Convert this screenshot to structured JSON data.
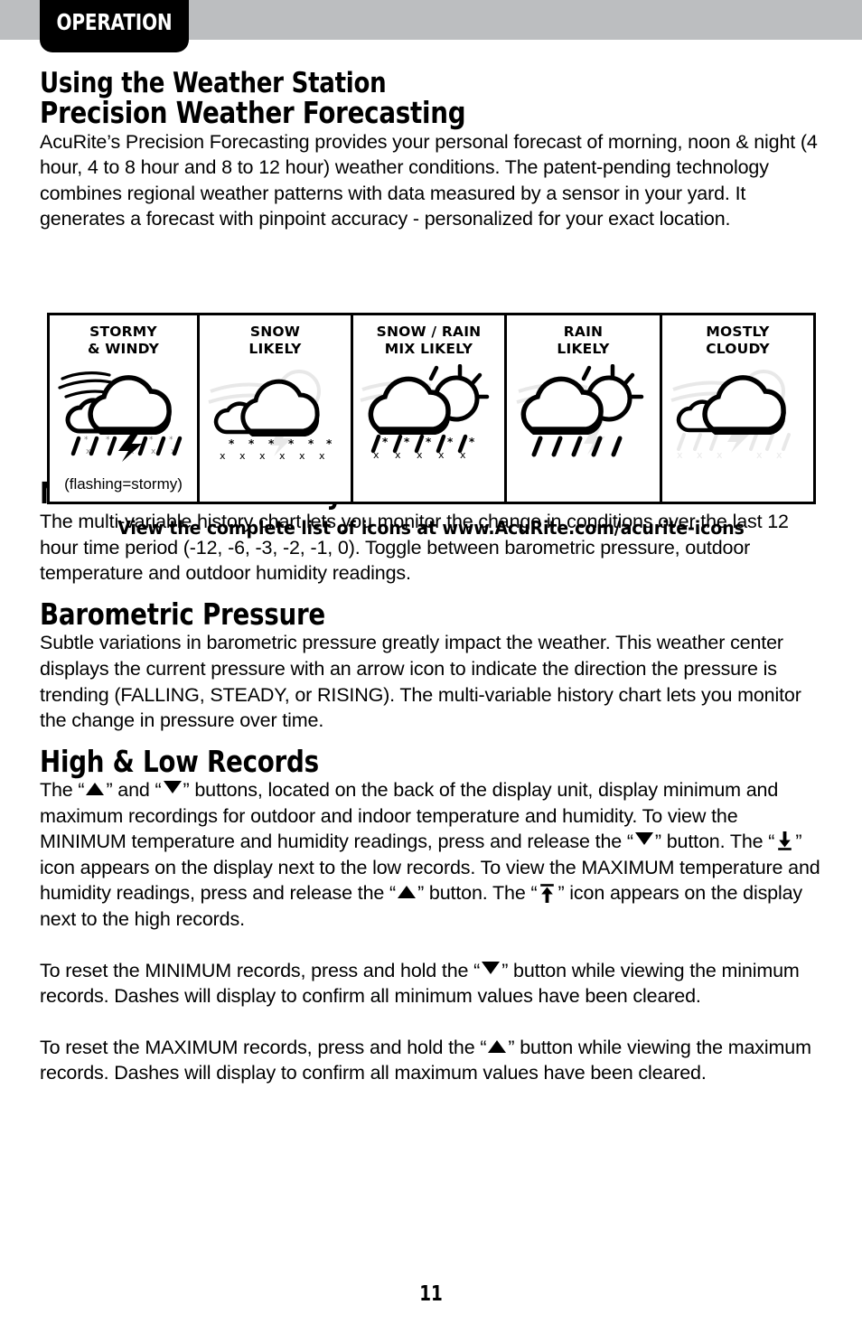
{
  "header": {
    "section_tab_label": "OPERATION",
    "bar_color": "#bcbec0",
    "tab_color": "#000000",
    "tab_text_color": "#ffffff"
  },
  "headings": {
    "page_title": "Using the Weather Station",
    "precision_forecasting": "Precision Weather Forecasting",
    "multi_variable_history_chart": "Multi-Variable History Chart",
    "barometric_pressure": "Barometric Pressure",
    "high_low_records": "High & Low Records"
  },
  "paragraphs": {
    "precision_body": "AcuRite’s Precision Forecasting provides your personal forecast of morning, noon & night (4 hour, 4 to 8 hour and 8 to 12 hour) weather conditions. The patent-pending technology combines regional weather patterns with data measured by a sensor in your yard. It generates a forecast with pinpoint accuracy - personalized for your exact location.",
    "multi_variable_body": "The multi-variable history chart lets you monitor the change in conditions over the last 12 hour time period (-12, -6, -3, -2, -1, 0). Toggle between barometric pressure, outdoor temperature and outdoor humidity readings.",
    "barometric_body": "Subtle variations in barometric pressure greatly impact the weather. This weather center displays the current pressure with an arrow icon to indicate the direction the pressure is trending (FALLING, STEADY, or RISING). The multi-variable history chart lets you monitor the change in pressure over time.",
    "records_p1_a": "The “",
    "records_p1_b": "” and “",
    "records_p1_c": "” buttons, located on the back of the display unit, display minimum and maximum recordings for outdoor and indoor temperature and humidity. To view the MINIMUM temperature and humidity readings, press and release the “",
    "records_p1_d": "” button. The “",
    "records_p1_e": "” icon appears on the display next to the low records. To view the MAXIMUM temperature and humidity readings, press and release the “",
    "records_p1_f": "” button. The “",
    "records_p1_g": "” icon appears on the display next to the high records.",
    "records_p2_a": "To reset the MINIMUM records, press and hold the “",
    "records_p2_b": "” button while viewing the minimum records. Dashes will display to confirm all minimum values have been cleared.",
    "records_p3_a": "To reset the MAXIMUM records, press and hold the “",
    "records_p3_b": "” button while viewing the maximum records. Dashes will display to confirm all maximum values have been cleared."
  },
  "forecast_table": {
    "columns": [
      {
        "label": "STORMY\n& WINDY",
        "icon": "stormy-windy-icon",
        "note": "(flashing=stormy)"
      },
      {
        "label": "SNOW\nLIKELY",
        "icon": "snow-likely-icon",
        "note": ""
      },
      {
        "label": "SNOW / RAIN\nMIX LIKELY",
        "icon": "snow-rain-mix-likely-icon",
        "note": ""
      },
      {
        "label": "RAIN\nLIKELY",
        "icon": "rain-likely-icon",
        "note": ""
      },
      {
        "label": "MOSTLY\nCLOUDY",
        "icon": "mostly-cloudy-icon",
        "note": ""
      }
    ]
  },
  "icons_link": {
    "text": "View the complete list of icons at www.AcuRite.com/acurite-icons"
  },
  "footer": {
    "page_number": "11"
  }
}
